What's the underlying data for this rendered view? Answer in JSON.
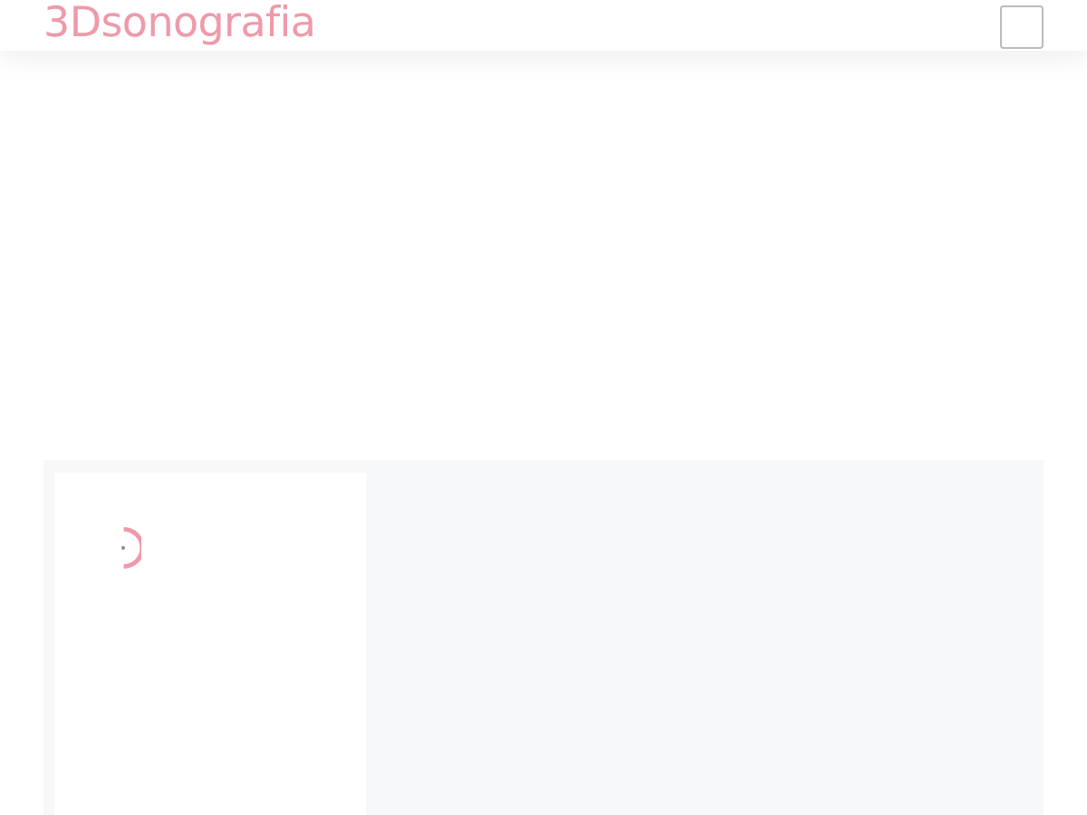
{
  "header": {
    "logo": "3Dsonografia"
  }
}
